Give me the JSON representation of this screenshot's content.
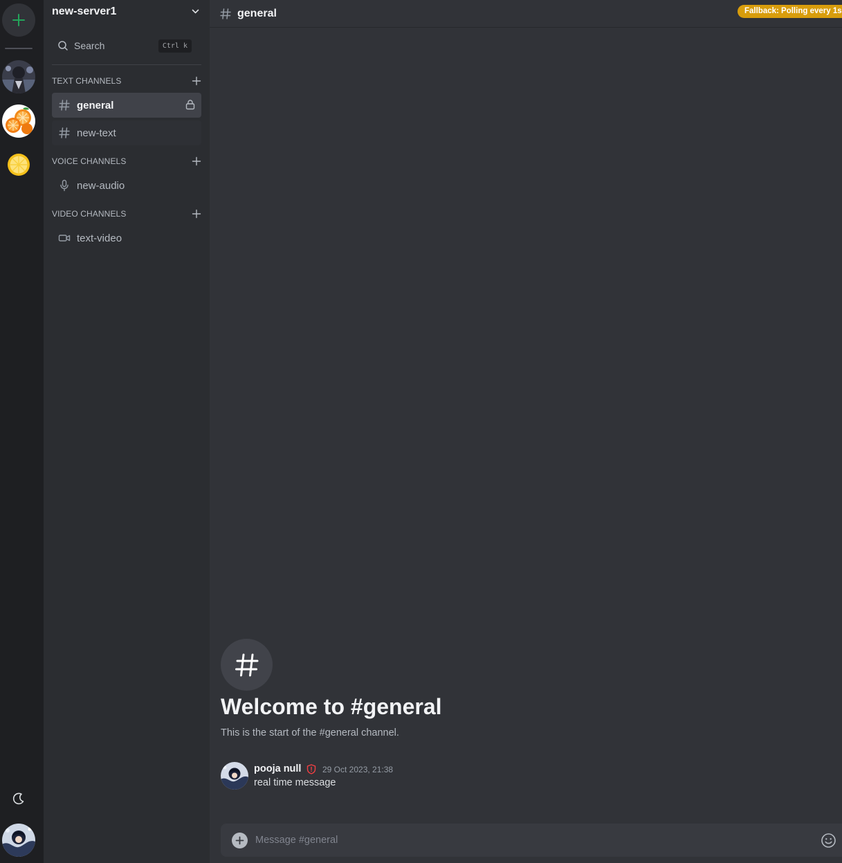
{
  "server": {
    "name": "new-server1"
  },
  "search": {
    "label": "Search",
    "shortcut": "Ctrl k"
  },
  "categories": {
    "text": "TEXT CHANNELS",
    "voice": "VOICE CHANNELS",
    "video": "VIDEO CHANNELS"
  },
  "channels": {
    "general": "general",
    "new_text": "new-text",
    "new_audio": "new-audio",
    "text_video": "text-video"
  },
  "header": {
    "channel": "general",
    "status_badge": "Fallback: Polling every 1s"
  },
  "welcome": {
    "title": "Welcome to #general",
    "subtitle": "This is the start of the #general channel."
  },
  "message": {
    "author": "pooja null",
    "timestamp": "29 Oct 2023, 21:38",
    "content": "real time message"
  },
  "composer": {
    "placeholder": "Message #general"
  },
  "colors": {
    "rail_bg": "#1e1f22",
    "sidebar_bg": "#2b2d31",
    "main_bg": "#313338",
    "accent_green": "#23a55a",
    "badge": "#d89d0c",
    "admin_shield": "#f23f43"
  }
}
